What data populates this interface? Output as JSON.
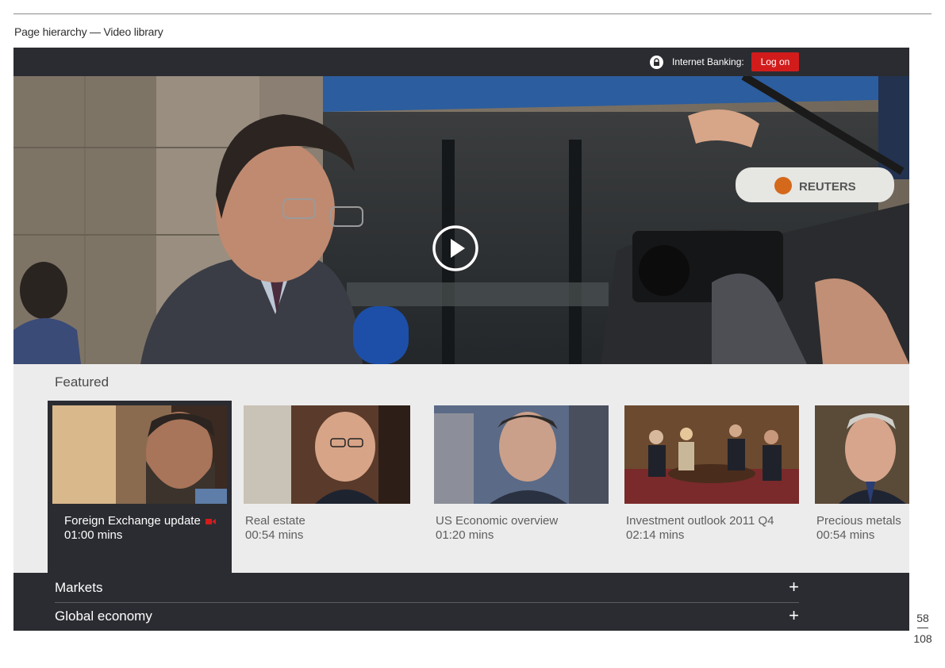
{
  "page": {
    "heading": "Page hierarchy — Video library",
    "current_page": "58",
    "total_pages": "108"
  },
  "topbar": {
    "banking_label": "Internet Banking:",
    "logon_label": "Log on",
    "lock_icon": "lock-icon"
  },
  "hero": {
    "play_icon": "play-icon",
    "mic_brand": "REUTERS"
  },
  "featured": {
    "title": "Featured",
    "items": [
      {
        "title": "Foreign Exchange update",
        "duration": "01:00 mins",
        "active": true,
        "badge_icon": "video-camera-icon"
      },
      {
        "title": "Real estate",
        "duration": "00:54 mins",
        "active": false
      },
      {
        "title": "US Economic overview",
        "duration": "01:20 mins",
        "active": false
      },
      {
        "title": "Investment outlook 2011 Q4",
        "duration": "02:14 mins",
        "active": false
      },
      {
        "title": "Precious metals",
        "duration": "00:54 mins",
        "active": false
      }
    ]
  },
  "accordion": [
    {
      "label": "Markets",
      "toggle": "+"
    },
    {
      "label": "Global economy",
      "toggle": "+"
    }
  ],
  "colors": {
    "dark_bar": "#2b2c31",
    "accent_red": "#d21c1c",
    "panel": "#ececec"
  }
}
